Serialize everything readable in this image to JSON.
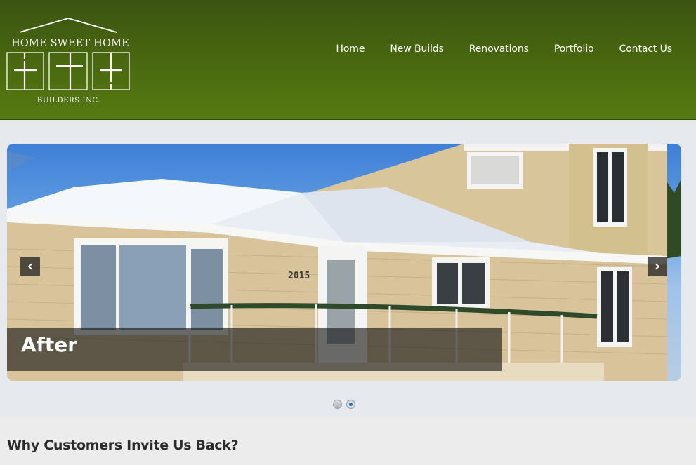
{
  "logo": {
    "title": "HOME SWEET HOME",
    "subtitle": "BUILDERS INC."
  },
  "nav": {
    "items": [
      "Home",
      "New Builds",
      "Renovations",
      "Portfolio",
      "Contact Us"
    ]
  },
  "slider": {
    "caption": "After",
    "house_number": "2015",
    "prev_icon": "chevron-left-icon",
    "next_icon": "chevron-right-icon",
    "prev_glyph": "‹",
    "next_glyph": "›",
    "slides_total": 2,
    "active_slide": 2
  },
  "section": {
    "heading": "Why Customers Invite Us Back?"
  },
  "colors": {
    "header_green": "#47650f",
    "page_bg": "#e6e9ee",
    "active_dot": "#2f78b8"
  }
}
